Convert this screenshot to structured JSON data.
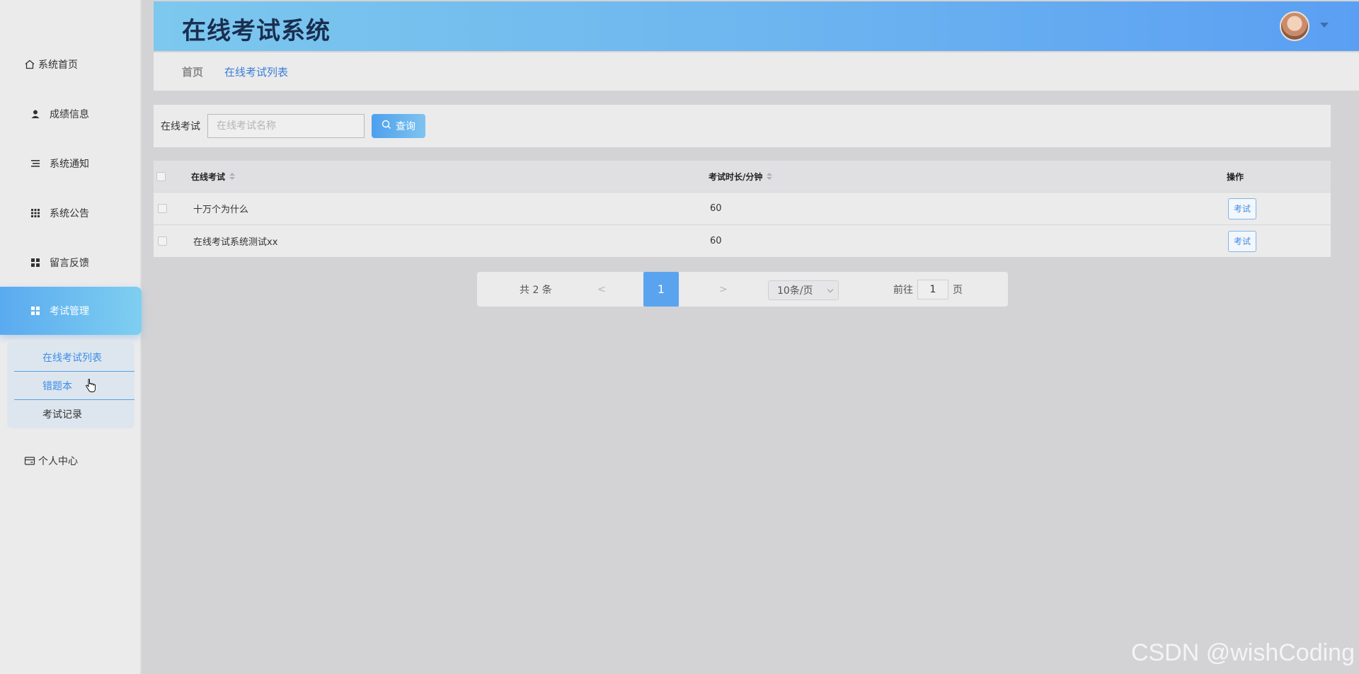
{
  "app": {
    "title": "在线考试系统"
  },
  "sidebar": {
    "items": [
      {
        "label": "系统首页",
        "icon": "home-icon"
      },
      {
        "label": "成绩信息",
        "icon": "user-icon"
      },
      {
        "label": "系统通知",
        "icon": "list-icon"
      },
      {
        "label": "系统公告",
        "icon": "grid-icon"
      },
      {
        "label": "留言反馈",
        "icon": "grid4-icon"
      },
      {
        "label": "考试管理",
        "icon": "grid4-icon",
        "active": true
      },
      {
        "label": "个人中心",
        "icon": "card-icon"
      }
    ],
    "submenu": [
      {
        "label": "在线考试列表",
        "active": true
      },
      {
        "label": "错题本"
      },
      {
        "label": "考试记录"
      }
    ]
  },
  "breadcrumb": {
    "home": "首页",
    "current": "在线考试列表"
  },
  "search": {
    "label": "在线考试",
    "placeholder": "在线考试名称",
    "value": "",
    "button": "查询"
  },
  "table": {
    "columns": [
      "在线考试",
      "考试时长/分钟",
      "操作"
    ],
    "rows": [
      {
        "name": "十万个为什么",
        "duration": "60",
        "action": "考试"
      },
      {
        "name": "在线考试系统测试xx",
        "duration": "60",
        "action": "考试"
      }
    ]
  },
  "pagination": {
    "total": "共 2 条",
    "prev": "<",
    "current": "1",
    "next": ">",
    "page_size": "10条/页",
    "goto_label": "前往",
    "goto_value": "1",
    "page_unit": "页"
  },
  "watermark": "CSDN @wishCoding",
  "colors": {
    "accent": "#5aa3ef",
    "header_start": "#7cc8ee",
    "header_end": "#5a9ff3",
    "title": "#1a2e50"
  }
}
